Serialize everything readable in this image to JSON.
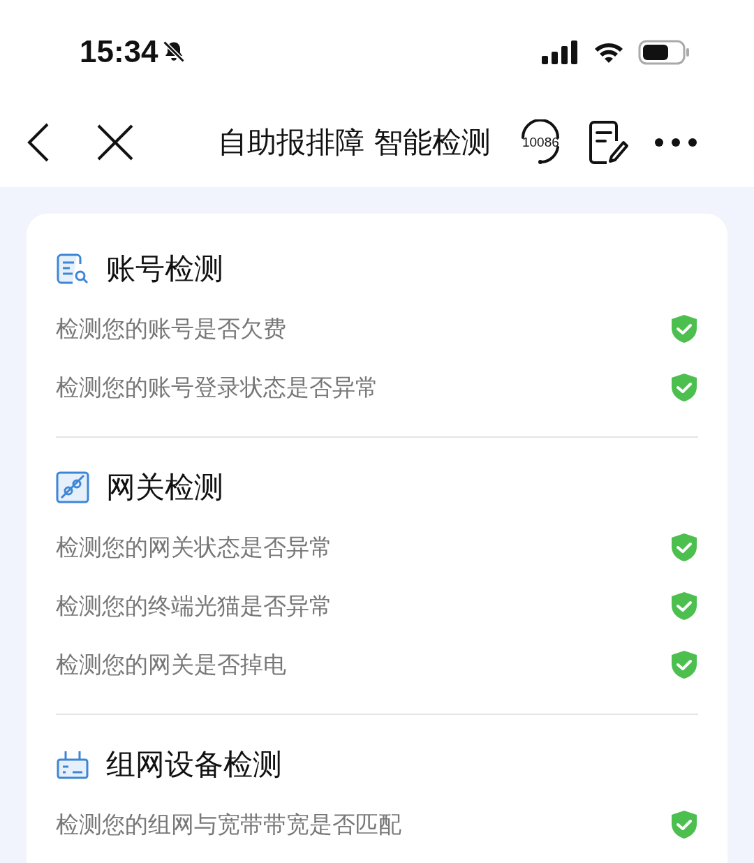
{
  "status_bar": {
    "time": "15:34",
    "silent": true
  },
  "nav_bar": {
    "title": "自助报排障 智能检测",
    "hotline": "10086"
  },
  "sections": [
    {
      "kind": "account",
      "title": "账号检测",
      "checks": [
        {
          "label": "检测您的账号是否欠费",
          "passed": true
        },
        {
          "label": "检测您的账号登录状态是否异常",
          "passed": true
        }
      ]
    },
    {
      "kind": "gateway",
      "title": "网关检测",
      "checks": [
        {
          "label": "检测您的网关状态是否异常",
          "passed": true
        },
        {
          "label": "检测您的终端光猫是否异常",
          "passed": true
        },
        {
          "label": "检测您的网关是否掉电",
          "passed": true
        }
      ]
    },
    {
      "kind": "network",
      "title": "组网设备检测",
      "checks": [
        {
          "label": "检测您的组网与宽带带宽是否匹配",
          "passed": true
        }
      ]
    }
  ]
}
